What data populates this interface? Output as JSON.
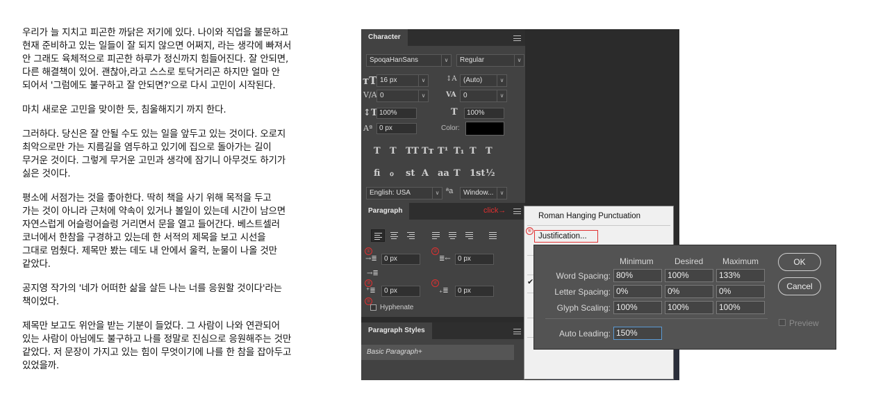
{
  "article": {
    "paragraphs": [
      [
        "우리가 늘 지치고 피곤한 까닭은 저기에 있다. 나이와 직업을 불문하고",
        "현재 준비하고 있는 일들이 잘 되지 않으면 어쩌지, 라는 생각에 빠져서",
        "안 그래도 육체적으로 피곤한 하루가 정신까지 힘들어진다. 잘 안되면,",
        "다른 해결책이 있어. 괜찮아,라고 스스로 토닥거리곤 하지만 얼마 안",
        "되어서 '그럼에도 불구하고 잘 안되면?'으로 다시 고민이 시작된다."
      ],
      [
        "마치 새로운 고민을 맞이한 듯, 침울해지기 까지 한다."
      ],
      [
        "그러하다. 당신은 잘 안될 수도 있는 일을 앞두고 있는 것이다. 오로지",
        "최악으로만 가는 지름길을 염두하고 있기에 집으로 돌아가는 길이",
        "무거운 것이다. 그렇게 무거운 고민과 생각에 잠기니 아무것도 하기가",
        "싫은 것이다."
      ],
      [
        "평소에 서점가는 것을 좋아한다. 딱히 책을 사기 위해 목적을 두고",
        "가는 것이 아니라 근처에 약속이 있거나 볼일이 있는데 시간이 남으면",
        "자연스럽게 어슬렁어슬렁 거리면서 문을 열고 들어간다. 베스트셀러",
        "코너에서 한참을 구경하고 있는데 한 서적의 제목을 보고 시선을",
        "그대로 멈췄다. 제목만 봤는 데도 내 안에서 울컥, 눈물이 나올 것만",
        "같았다."
      ],
      [
        "공지영 작가의 '네가 어떠한 삶을 살든 나는 너를 응원할 것이다'라는",
        "책이었다."
      ],
      [
        "제목만 보고도 위안을 받는 기분이 들었다. 그 사람이 나와 연관되어",
        "있는 사람이 아님에도 불구하고 나를 정말로 진심으로 응원해주는 것만",
        "같았다. 저 문장이 가지고 있는 힘이 무엇이기에 나를 한 참을 잡아두고",
        "있었을까."
      ]
    ]
  },
  "character_panel": {
    "tab": "Character",
    "font_family": "SpoqaHanSans",
    "font_style": "Regular",
    "size": "16 px",
    "leading": "(Auto)",
    "kerning": "0",
    "tracking": "0",
    "v_scale": "100%",
    "h_scale": "100%",
    "baseline": "0 px",
    "color_label": "Color:",
    "type_buttons": [
      "T",
      "T",
      "TT",
      "Tт",
      "T¹",
      "T₁",
      "T",
      "T"
    ],
    "opentype_buttons": [
      "fi",
      "ℴ",
      "st",
      "A",
      "aa",
      "T",
      "1st",
      "½"
    ],
    "language": "English: USA",
    "aa_label": "a",
    "antialias": "Window..."
  },
  "paragraph_panel": {
    "tab": "Paragraph",
    "click_label": "click",
    "indent_left": "0 px",
    "indent_right": "0 px",
    "indent_first": "0 px",
    "space_before": "0 px",
    "space_after": "0 px",
    "hyphenate_label": "Hyphenate",
    "markers": [
      "①",
      "②",
      "③",
      "④",
      "⑤",
      "⑥"
    ]
  },
  "paragraph_styles_panel": {
    "tab": "Paragraph Styles",
    "item": "Basic Paragraph+"
  },
  "flyout": {
    "item_1": "Roman Hanging Punctuation",
    "item_2": "Justification..."
  },
  "justification_dialog": {
    "headers": [
      "Minimum",
      "Desired",
      "Maximum"
    ],
    "rows": [
      {
        "label": "Word Spacing:",
        "values": [
          "80%",
          "100%",
          "133%"
        ]
      },
      {
        "label": "Letter Spacing:",
        "values": [
          "0%",
          "0%",
          "0%"
        ]
      },
      {
        "label": "Glyph Scaling:",
        "values": [
          "100%",
          "100%",
          "100%"
        ]
      }
    ],
    "auto_leading_label": "Auto Leading:",
    "auto_leading_value": "150%",
    "ok": "OK",
    "cancel": "Cancel",
    "preview": "Preview"
  },
  "colors": {
    "panel_bg": "#424242",
    "accent_red": "#e03030",
    "dialog_bg": "#535353"
  }
}
